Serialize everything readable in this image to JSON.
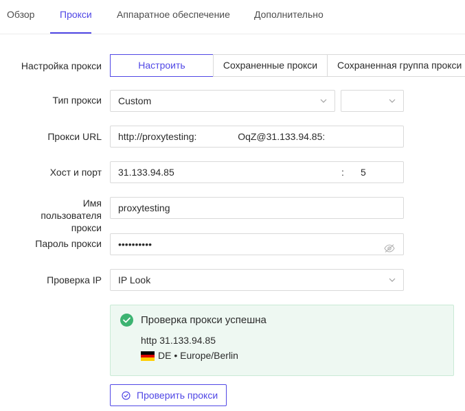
{
  "tabs": [
    {
      "label": "Обзор"
    },
    {
      "label": "Прокси"
    },
    {
      "label": "Аппаратное обеспечение"
    },
    {
      "label": "Дополнительно"
    }
  ],
  "form": {
    "proxy_settings_label": "Настройка прокси",
    "segments": [
      "Настроить",
      "Сохраненные прокси",
      "Сохраненная группа прокси"
    ],
    "proxy_type_label": "Тип прокси",
    "proxy_type_value": "Custom",
    "proxy_url_label": "Прокси URL",
    "proxy_url_value_a": "http://proxytesting:",
    "proxy_url_value_b": "OqZ@31.133.94.85:",
    "host_port_label": "Хост и порт",
    "host_value": "31.133.94.85",
    "port_separator": ":",
    "port_value": "5",
    "username_label": "Имя пользователя прокси",
    "username_value": "proxytesting",
    "password_label": "Пароль прокси",
    "password_value": "••••••••••",
    "ip_check_label": "Проверка IP",
    "ip_check_value": "IP Look"
  },
  "result": {
    "title": "Проверка прокси успешна",
    "line1": "http 31.133.94.85",
    "location": "DE • Europe/Berlin",
    "status_color": "#3cb371"
  },
  "actions": {
    "check_button": "Проверить прокси"
  },
  "colors": {
    "accent": "#4f46e5",
    "success_bg": "#eef8f2"
  }
}
